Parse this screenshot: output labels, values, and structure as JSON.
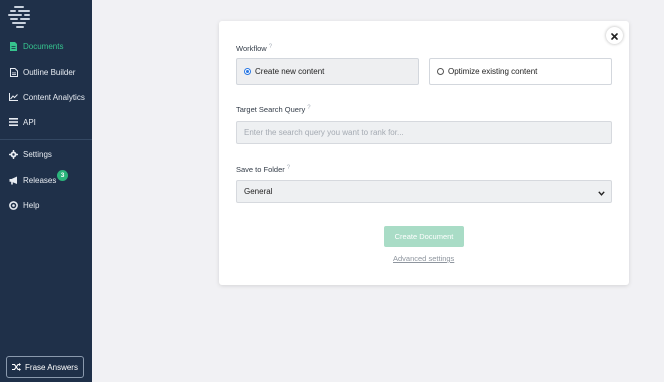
{
  "sidebar": {
    "items": [
      {
        "label": "Documents",
        "icon": "document-icon"
      },
      {
        "label": "Outline Builder",
        "icon": "outline-icon"
      },
      {
        "label": "Content Analytics",
        "icon": "analytics-icon"
      },
      {
        "label": "API",
        "icon": "api-icon"
      },
      {
        "label": "Settings",
        "icon": "gear-icon"
      },
      {
        "label": "Releases",
        "icon": "megaphone-icon"
      },
      {
        "label": "Help",
        "icon": "lifebuoy-icon"
      }
    ],
    "releases_badge": "3",
    "answers_button": "Frase Answers",
    "active_color": "#36c48e"
  },
  "modal": {
    "workflow_label": "Workflow",
    "help_mark": "?",
    "options": [
      {
        "label": "Create new content",
        "selected": true
      },
      {
        "label": "Optimize existing content",
        "selected": false
      }
    ],
    "query_label": "Target Search Query",
    "query_placeholder": "Enter the search query you want to rank for...",
    "query_value": "",
    "folder_label": "Save to Folder",
    "folder_value": "General",
    "create_button": "Create Document",
    "advanced_link": "Advanced settings",
    "accent_color": "#a9dcc6"
  }
}
